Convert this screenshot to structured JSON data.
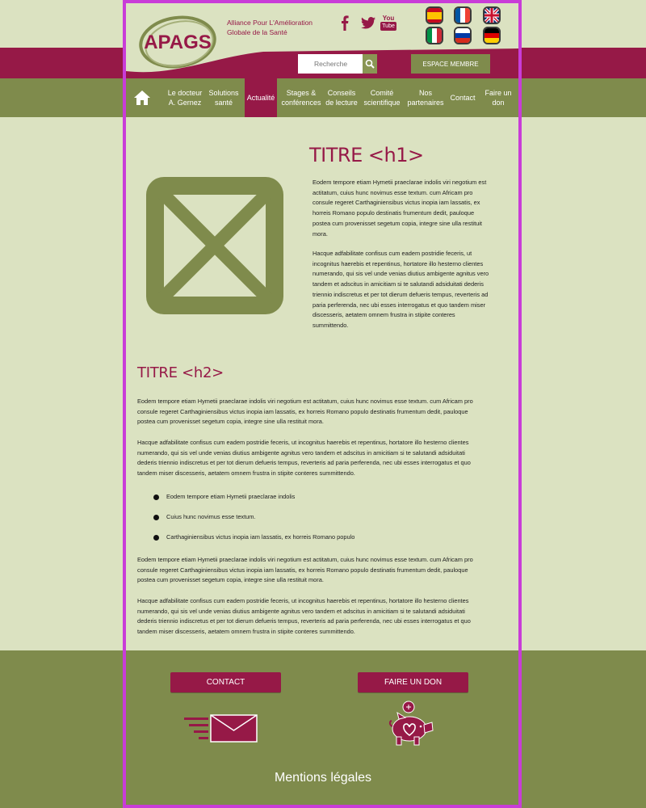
{
  "header": {
    "logo_text": "APAGS",
    "tagline_line1": "Alliance Pour L'Amélioration",
    "tagline_line2": "Globale de la Santé",
    "social": [
      {
        "name": "facebook-icon",
        "glyph": "f"
      },
      {
        "name": "twitter-icon",
        "glyph": "twitter"
      },
      {
        "name": "youtube-icon",
        "glyph": "You Tube"
      }
    ],
    "youtube_top": "You",
    "youtube_bottom": "Tube",
    "languages": [
      "es",
      "fr",
      "en",
      "it",
      "ru",
      "de"
    ],
    "search_placeholder": "Recherche",
    "member_label": "ESPACE MEMBRE"
  },
  "nav": {
    "items": [
      {
        "line1": "Le docteur",
        "line2": "A. Gernez"
      },
      {
        "line1": "Solutions",
        "line2": "santé"
      },
      {
        "line1": "Actualité",
        "line2": ""
      },
      {
        "line1": "Stages &",
        "line2": "conférences"
      },
      {
        "line1": "Conseils",
        "line2": "de lecture"
      },
      {
        "line1": "Comité",
        "line2": "scientifique"
      },
      {
        "line1": "Nos",
        "line2": "partenaires"
      },
      {
        "line1": "Contact",
        "line2": ""
      },
      {
        "line1": "Faire un",
        "line2": "don"
      }
    ],
    "active_index": 2
  },
  "article": {
    "h1": "TITRE <h1>",
    "intro_p1": "Eodem tempore etiam Hymetii praeclarae indolis viri negotium est actitatum, cuius hunc novimus esse textum. cum Africam pro consule regeret Carthaginiensibus victus inopia iam lassatis, ex horreis Romano populo destinatis frumentum dedit, pauloque postea cum provenisset segetum copia, integre sine ulla restituit mora.",
    "intro_p2": "Hacque adfabilitate confisus cum eadem postridie feceris, ut incognitus haerebis et repentinus, hortatore illo hesterno clientes numerando, qui sis vel unde venias diutius ambigente agnitus vero tandem et adscitus in amicitiam si te salutandi adsiduitati dederis triennio indiscretus et per tot dierum defueris tempus, reverteris ad paria perferenda, nec ubi esses interrogatus et quo tandem miser discesseris, aetatem omnem frustra in stipite conteres summittendo.",
    "h2": "TITRE <h2>",
    "body_p1": "Eodem tempore etiam Hymetii praeclarae indolis viri negotium est actitatum, cuius hunc novimus esse textum. cum Africam pro consule regeret Carthaginiensibus victus inopia iam lassatis, ex horreis Romano populo destinatis frumentum dedit, pauloque postea cum provenisset segetum copia, integre sine ulla restituit mora.",
    "body_p2": "Hacque adfabilitate confisus cum eadem postridie feceris, ut incognitus haerebis et repentinus, hortatore illo hesterno clientes numerando, qui sis vel unde venias diutius ambigente agnitus vero tandem et adscitus in amicitiam si te salutandi adsiduitati dederis triennio indiscretus et per tot dierum defueris tempus, reverteris ad paria perferenda, nec ubi esses interrogatus et quo tandem miser discesseris, aetatem omnem frustra in stipite conteres summittendo.",
    "bullets": [
      "Eodem tempore etiam Hymetii praeclarae indolis",
      "Cuius hunc novimus esse textum.",
      "Carthaginiensibus victus inopia iam lassatis, ex horreis Romano populo"
    ],
    "body_p3": "Eodem tempore etiam Hymetii praeclarae indolis viri negotium est actitatum, cuius hunc novimus esse textum. cum Africam pro consule regeret Carthaginiensibus victus inopia iam lassatis, ex horreis Romano populo destinatis frumentum dedit, pauloque postea cum provenisset segetum copia, integre sine ulla restituit mora.",
    "body_p4": "Hacque adfabilitate confisus cum eadem postridie feceris, ut incognitus haerebis et repentinus, hortatore illo hesterno clientes numerando, qui sis vel unde venias diutius ambigente agnitus vero tandem et adscitus in amicitiam si te salutandi adsiduitati dederis triennio indiscretus et per tot dierum defueris tempus, reverteris ad paria perferenda, nec ubi esses interrogatus et quo tandem miser discesseris, aetatem omnem frustra in stipite conteres summittendo."
  },
  "footer": {
    "contact_label": "CONTACT",
    "donate_label": "FAIRE UN DON",
    "legal_label": "Mentions légales"
  },
  "colors": {
    "brand": "#961947",
    "olive": "#7f8b4c",
    "background": "#dbe2c1"
  }
}
